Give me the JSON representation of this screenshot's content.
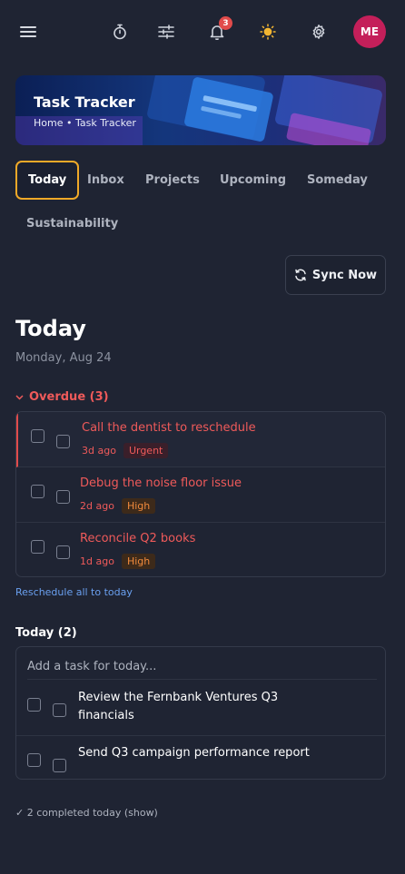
{
  "header": {
    "notification_count": "3",
    "avatar_initials": "ME"
  },
  "banner": {
    "title": "Task Tracker",
    "breadcrumb": "Home • Task Tracker"
  },
  "tabs": [
    {
      "label": "Today",
      "active": true
    },
    {
      "label": "Inbox"
    },
    {
      "label": "Projects"
    },
    {
      "label": "Upcoming"
    },
    {
      "label": "Someday"
    },
    {
      "label": "Sustainability"
    }
  ],
  "sync_label": "Sync Now",
  "page": {
    "title": "Today",
    "date": "Monday, Aug 24"
  },
  "overdue": {
    "heading": "Overdue (3)",
    "tasks": [
      {
        "title": "Call the dentist to reschedule",
        "ago": "3d ago",
        "priority": "Urgent"
      },
      {
        "title": "Debug the noise floor issue",
        "ago": "2d ago",
        "priority": "High"
      },
      {
        "title": "Reconcile Q2 books",
        "ago": "1d ago",
        "priority": "High"
      }
    ],
    "reschedule_label": "Reschedule all to today"
  },
  "today": {
    "heading": "Today (2)",
    "placeholder": "Add a task for today...",
    "tasks": [
      {
        "title": "Review the Fernbank Ventures Q3 financials"
      },
      {
        "title": "Send Q3 campaign performance report"
      }
    ],
    "completed_label": "✓ 2 completed today (show)"
  },
  "colors": {
    "accent": "#f0a928",
    "danger": "#ef5a5a",
    "high": "#f08a3c",
    "link": "#6aa0f0",
    "avatar": "#c41f5a"
  }
}
